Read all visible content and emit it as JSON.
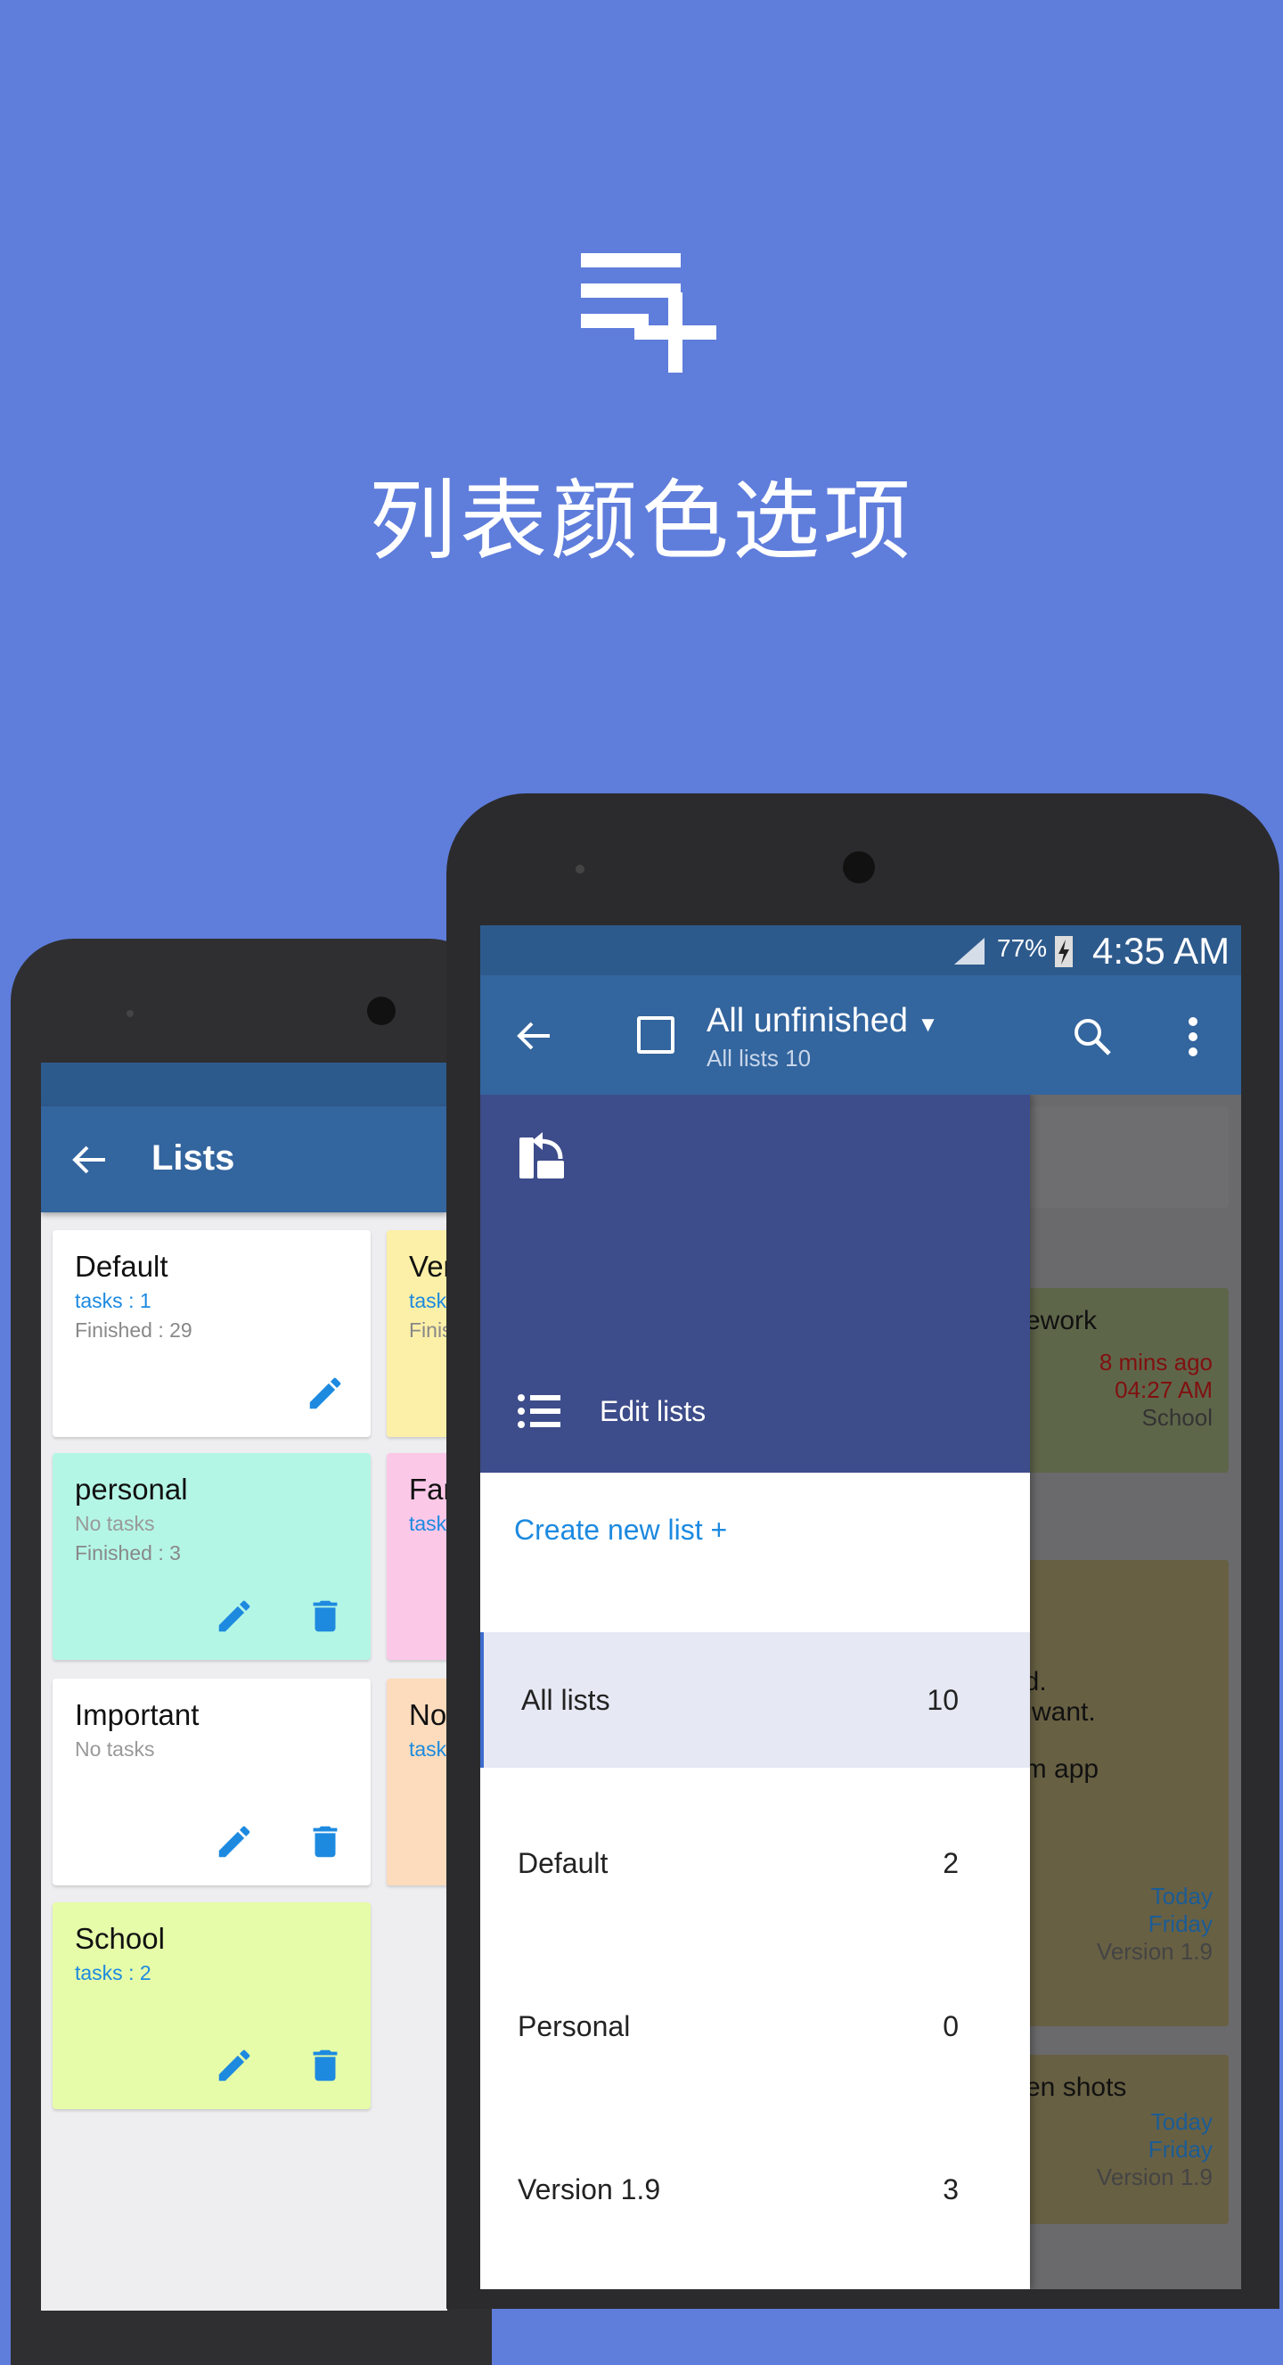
{
  "hero": {
    "icon": "playlist-add-icon",
    "title": "列表颜色选项"
  },
  "back_phone": {
    "toolbar": {
      "title": "Lists",
      "back_icon": "arrow-back-icon"
    },
    "cards": [
      {
        "name": "Default",
        "tasks": "tasks : 1",
        "finished": "Finished : 29",
        "color": "#ffffff"
      },
      {
        "name": "Ver",
        "tasks": "task",
        "finished": "Finis",
        "color": "#fcf0a8"
      },
      {
        "name": "personal",
        "tasks": "No tasks",
        "finished": "Finished : 3",
        "color": "#b4f6e6"
      },
      {
        "name": "Far",
        "tasks": "task",
        "finished": "",
        "color": "#fcc8e8"
      },
      {
        "name": "Important",
        "tasks": "No tasks",
        "finished": "",
        "color": "#ffffff"
      },
      {
        "name": "No",
        "tasks": "task",
        "finished": "",
        "color": "#fcdcbc"
      },
      {
        "name": "School",
        "tasks": "tasks : 2",
        "finished": "",
        "color": "#e6fca8"
      }
    ]
  },
  "front_phone": {
    "status": {
      "battery": "77%",
      "time": "4:35 AM"
    },
    "toolbar": {
      "title": "All unfinished",
      "subtitle": "All lists 10"
    },
    "drawer": {
      "edit_lists": "Edit lists",
      "create": "Create new list +",
      "lists": [
        {
          "name": "All lists",
          "count": "10",
          "selected": true
        },
        {
          "name": "Default",
          "count": "2"
        },
        {
          "name": "Personal",
          "count": "0"
        },
        {
          "name": "Version 1.9",
          "count": "3"
        }
      ]
    },
    "background": {
      "c1": {
        "title": "ework",
        "due": "8 mins ago",
        "time": "04:27 AM",
        "list": "School"
      },
      "c2": {
        "l1": "od.",
        "l2": "u want.",
        "l3": "om app",
        "d1": "Today",
        "d2": "Friday",
        "list": "Version 1.9"
      },
      "c3": {
        "title": "en shots",
        "d1": "Today",
        "d2": "Friday",
        "list": "Version 1.9"
      }
    }
  },
  "colors": {
    "background": "#5f7ddb",
    "toolbar": "#33659e",
    "drawer_header": "#3d4c8a",
    "accent": "#1d8ae0"
  }
}
